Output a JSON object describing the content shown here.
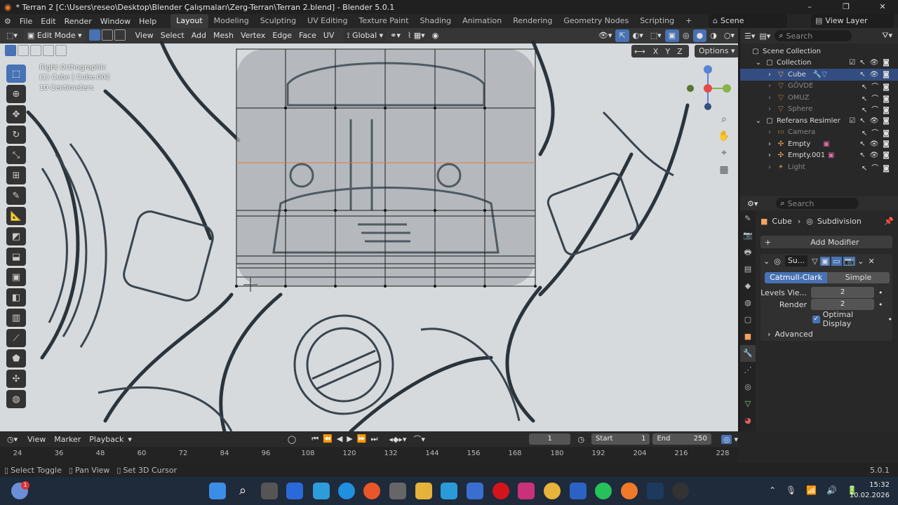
{
  "window": {
    "title": "* Terran 2 [C:\\Users\\reseo\\Desktop\\Blender Çalışmaları\\Zerg-Terran\\Terran 2.blend] - Blender 5.0.1"
  },
  "menu": {
    "file": "File",
    "edit": "Edit",
    "render": "Render",
    "window": "Window",
    "help": "Help"
  },
  "workspaces": [
    "Layout",
    "Modeling",
    "Sculpting",
    "UV Editing",
    "Texture Paint",
    "Shading",
    "Animation",
    "Rendering",
    "Geometry Nodes",
    "Scripting"
  ],
  "scene": {
    "label": "Scene",
    "viewlayer": "View Layer"
  },
  "viewport_header": {
    "mode": "Edit Mode",
    "view": "View",
    "select": "Select",
    "add": "Add",
    "mesh": "Mesh",
    "vertex": "Vertex",
    "edge": "Edge",
    "face": "Face",
    "uv": "UV",
    "orientation": "Global",
    "options": "Options",
    "axes": [
      "X",
      "Y",
      "Z"
    ]
  },
  "viewport_info": {
    "view_name": "Right Orthographic",
    "object": "(1) Cube | Cube.002",
    "scale": "10 Centimeters"
  },
  "outliner": {
    "search_placeholder": "Search",
    "rows": [
      {
        "label": "Scene Collection"
      },
      {
        "label": "Collection"
      },
      {
        "label": "Cube"
      },
      {
        "label": "GÖVDE"
      },
      {
        "label": "OMUZ"
      },
      {
        "label": "Sphere"
      },
      {
        "label": "Referans Resimler"
      },
      {
        "label": "Camera"
      },
      {
        "label": "Empty"
      },
      {
        "label": "Empty.001"
      },
      {
        "label": "Light"
      }
    ]
  },
  "properties": {
    "search_placeholder": "Search",
    "breadcrumb_object": "Cube",
    "breadcrumb_modifier": "Subdivision",
    "add_modifier": "Add Modifier",
    "modifier_name": "Su...",
    "catmull": "Catmull-Clark",
    "simple": "Simple",
    "levels_label": "Levels Vie...",
    "levels_value": "2",
    "render_label": "Render",
    "render_value": "2",
    "optimal_display": "Optimal Display",
    "advanced": "Advanced"
  },
  "timeline": {
    "view": "View",
    "marker": "Marker",
    "playback": "Playback",
    "current_frame": "1",
    "start_label": "Start",
    "start_value": "1",
    "end_label": "End",
    "end_value": "250",
    "ticks": [
      "24",
      "36",
      "48",
      "60",
      "72",
      "84",
      "96",
      "108",
      "120",
      "132",
      "144",
      "156",
      "168",
      "180",
      "192",
      "204",
      "216",
      "228"
    ]
  },
  "status": {
    "select_toggle": "Select Toggle",
    "pan_view": "Pan View",
    "set_cursor": "Set 3D Cursor",
    "version": "5.0.1"
  },
  "taskbar": {
    "time": "15:32",
    "date": "10.02.2026"
  },
  "colors": {
    "accent": "#4772b3",
    "selection": "#334d80",
    "taskbar": "#1f2a3a"
  }
}
